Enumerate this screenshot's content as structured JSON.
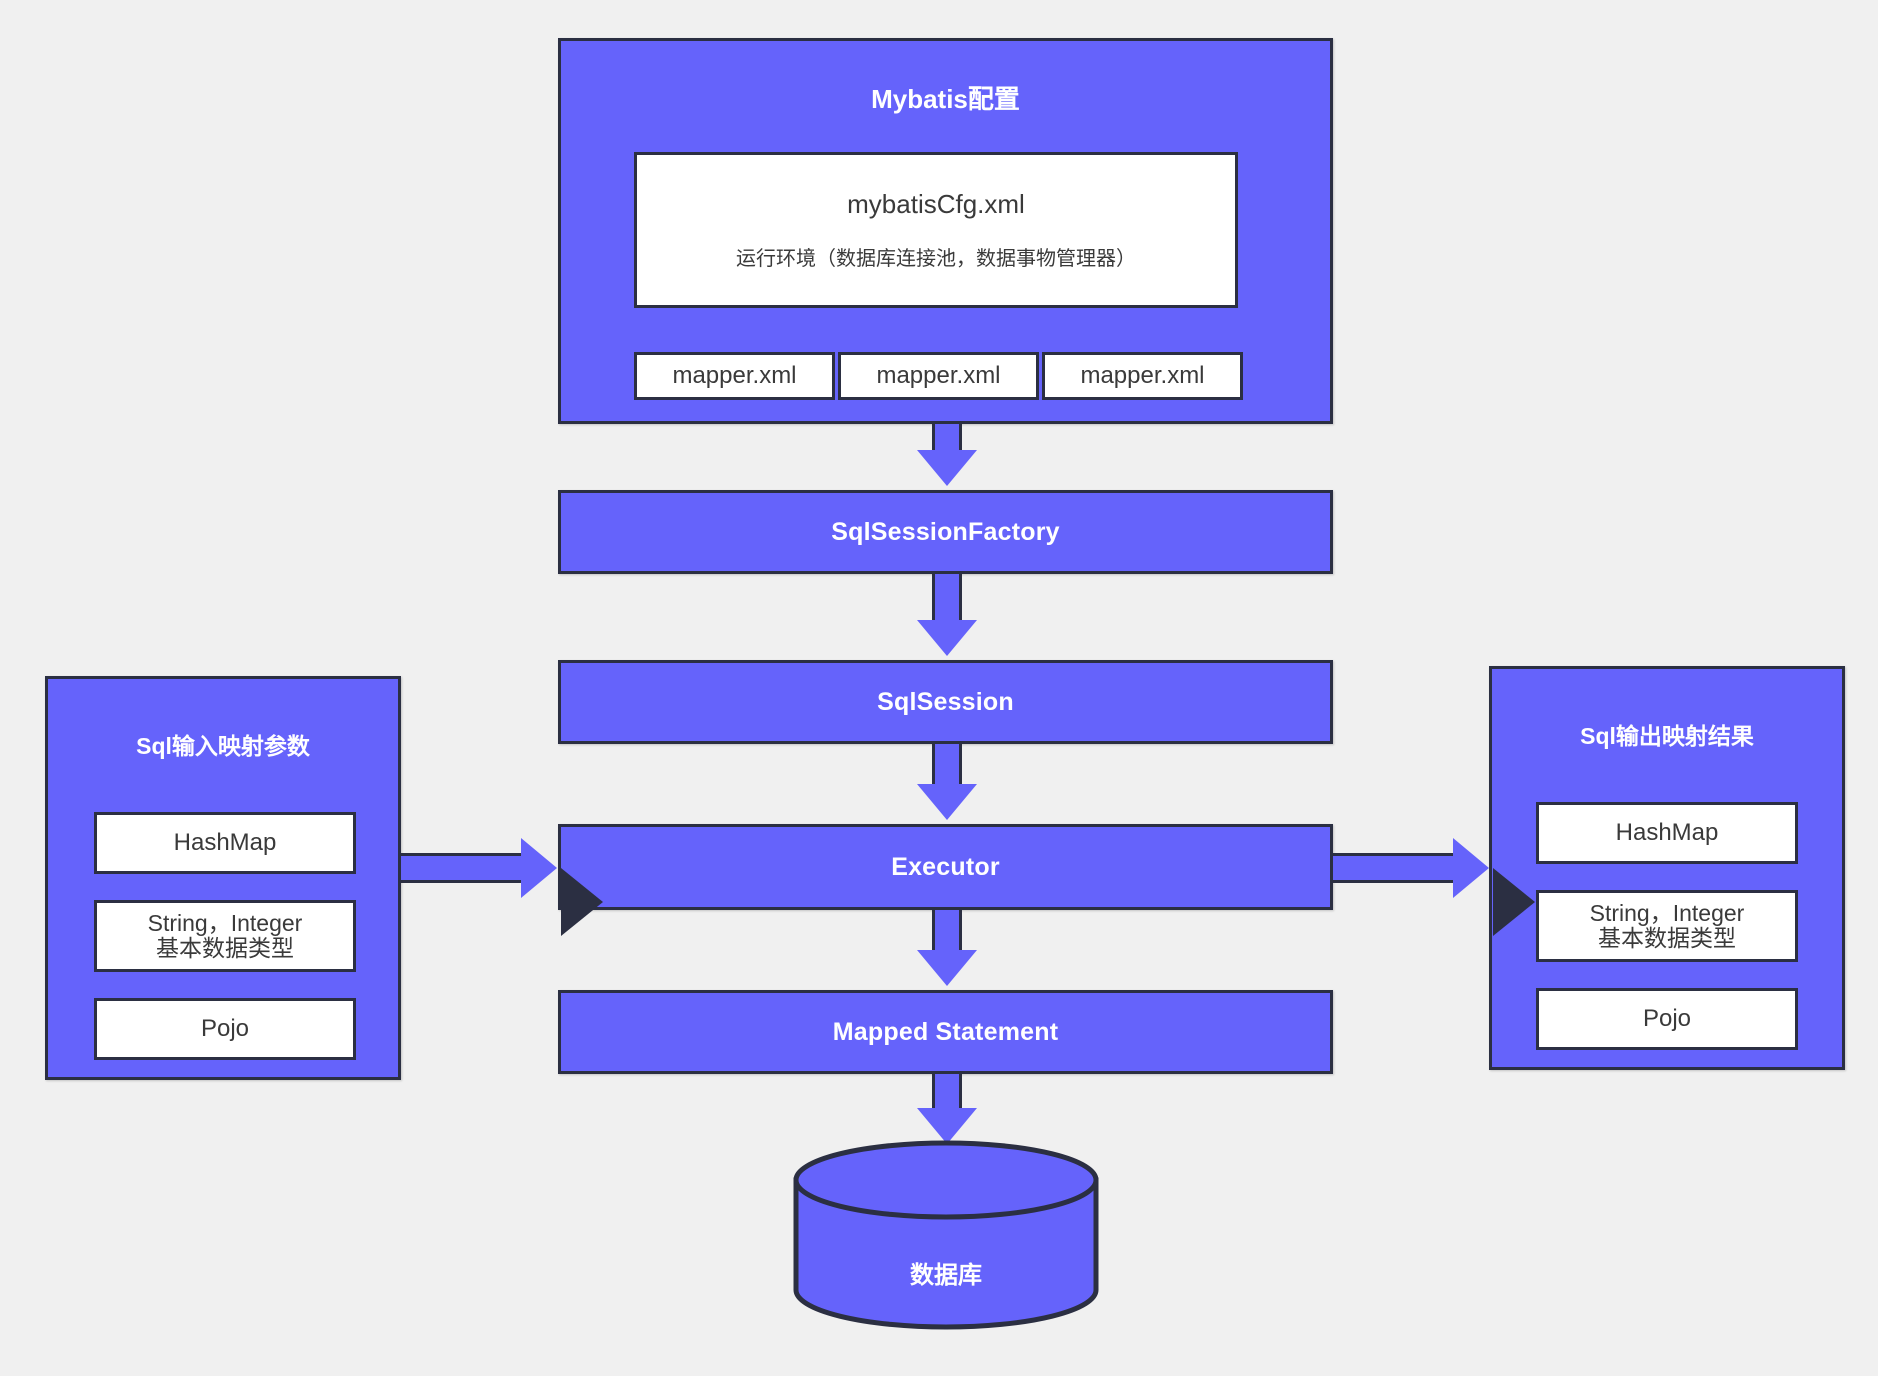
{
  "colors": {
    "background": "#f0f0f0",
    "node_fill": "#6563fb",
    "node_border": "#2b2f42",
    "card_fill": "#ffffff",
    "card_text": "#3a3a3a",
    "node_text": "#ffffff"
  },
  "config_group": {
    "title": "Mybatis配置",
    "config_file": {
      "name": "mybatisCfg.xml",
      "description": "运行环境（数据库连接池，数据事物管理器）"
    },
    "mappers": [
      {
        "label": "mapper.xml"
      },
      {
        "label": "mapper.xml"
      },
      {
        "label": "mapper.xml"
      }
    ]
  },
  "pipeline": [
    {
      "label": "SqlSessionFactory"
    },
    {
      "label": "SqlSession"
    },
    {
      "label": "Executor"
    },
    {
      "label": "Mapped Statement"
    }
  ],
  "input_panel": {
    "title": "Sql输入映射参数",
    "items": [
      {
        "line1": "HashMap",
        "line2": ""
      },
      {
        "line1": "String，Integer",
        "line2": "基本数据类型"
      },
      {
        "line1": "Pojo",
        "line2": ""
      }
    ]
  },
  "output_panel": {
    "title": "Sql输出映射结果",
    "items": [
      {
        "line1": "HashMap",
        "line2": ""
      },
      {
        "line1": "String，Integer",
        "line2": "基本数据类型"
      },
      {
        "line1": "Pojo",
        "line2": ""
      }
    ]
  },
  "database": {
    "label": "数据库"
  },
  "arrows": {
    "config_to_factory": "down-arrow",
    "factory_to_session": "down-arrow",
    "session_to_executor": "down-arrow",
    "executor_to_statement": "down-arrow",
    "statement_to_database": "down-arrow",
    "input_to_executor": "right-arrow",
    "executor_to_output": "right-arrow"
  }
}
